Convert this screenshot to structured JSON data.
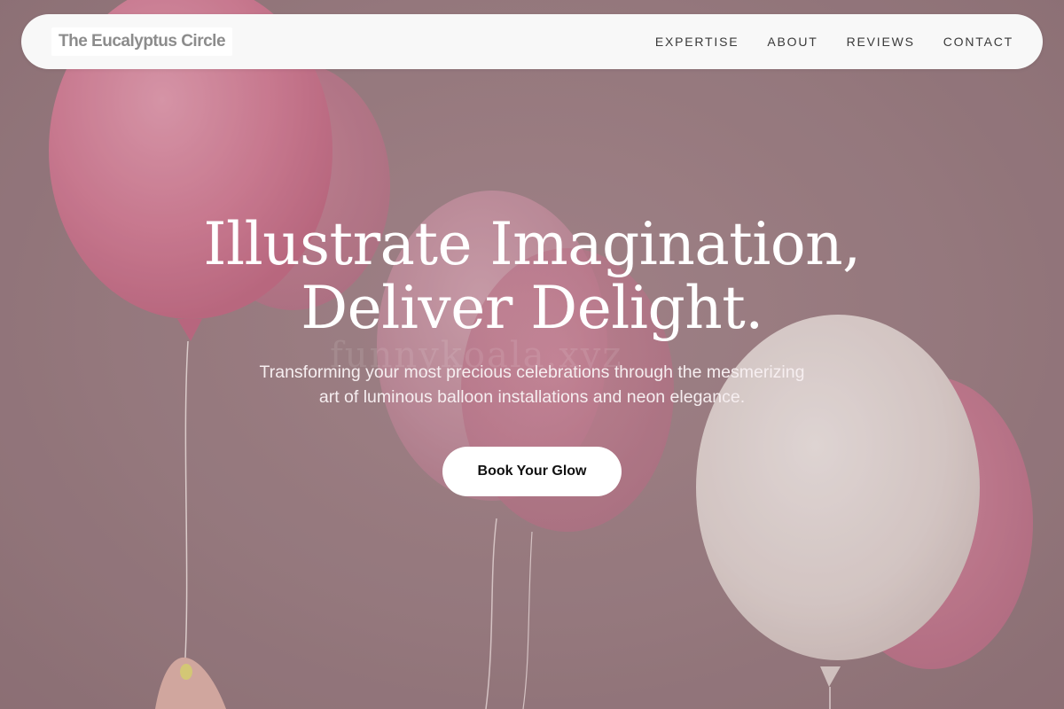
{
  "site": {
    "logo_text": "The Eucalyptus Circle"
  },
  "nav": {
    "items": [
      {
        "label": "EXPERTISE"
      },
      {
        "label": "ABOUT"
      },
      {
        "label": "REVIEWS"
      },
      {
        "label": "CONTACT"
      }
    ]
  },
  "hero": {
    "headline_line1": "Illustrate Imagination,",
    "headline_line2": "Deliver Delight.",
    "subtitle_line1": "Transforming your most precious celebrations through the mesmerizing",
    "subtitle_line2": "art of luminous balloon installations and neon elegance.",
    "cta_label": "Book Your Glow",
    "watermark": "funnykoala.xyz"
  },
  "colors": {
    "navbar_bg": "#f8f8f8",
    "hero_overlay": "#9a7e83",
    "headline": "#ffffff",
    "cta_bg": "#ffffff",
    "cta_text": "#111111",
    "balloon_pink": "#d97b97",
    "balloon_white": "#f3ece9"
  }
}
